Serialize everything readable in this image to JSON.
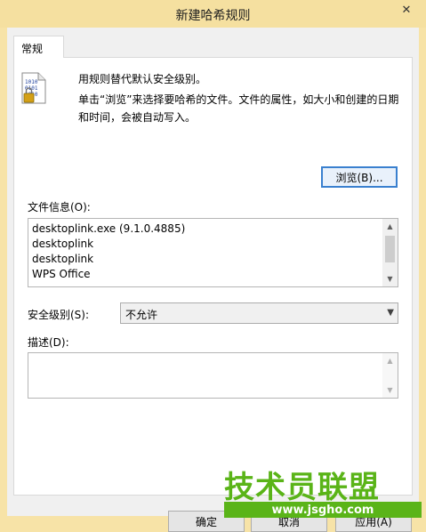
{
  "window": {
    "title": "新建哈希规则",
    "close_glyph": "✕"
  },
  "tab": {
    "label": "常规"
  },
  "description": {
    "line1": "用规则替代默认安全级别。",
    "line2": "单击“浏览”来选择要哈希的文件。文件的属性，如大小和创建的日期和时间，会被自动写入。"
  },
  "browse_button": {
    "label": "浏览(B)..."
  },
  "file_info": {
    "label": "文件信息(O):",
    "lines": [
      "desktoplink.exe (9.1.0.4885)",
      "desktoplink",
      "desktoplink",
      "WPS Office"
    ]
  },
  "security_level": {
    "label": "安全级别(S):",
    "value": "不允许"
  },
  "notes": {
    "label": "描述(D):",
    "value": ""
  },
  "buttons": {
    "ok": "确定",
    "cancel": "取消",
    "apply": "应用(A)"
  },
  "watermark": {
    "text": "技术员联盟",
    "url": "www.jsgho.com"
  },
  "icons": {
    "file": "binary-file-lock-icon"
  }
}
